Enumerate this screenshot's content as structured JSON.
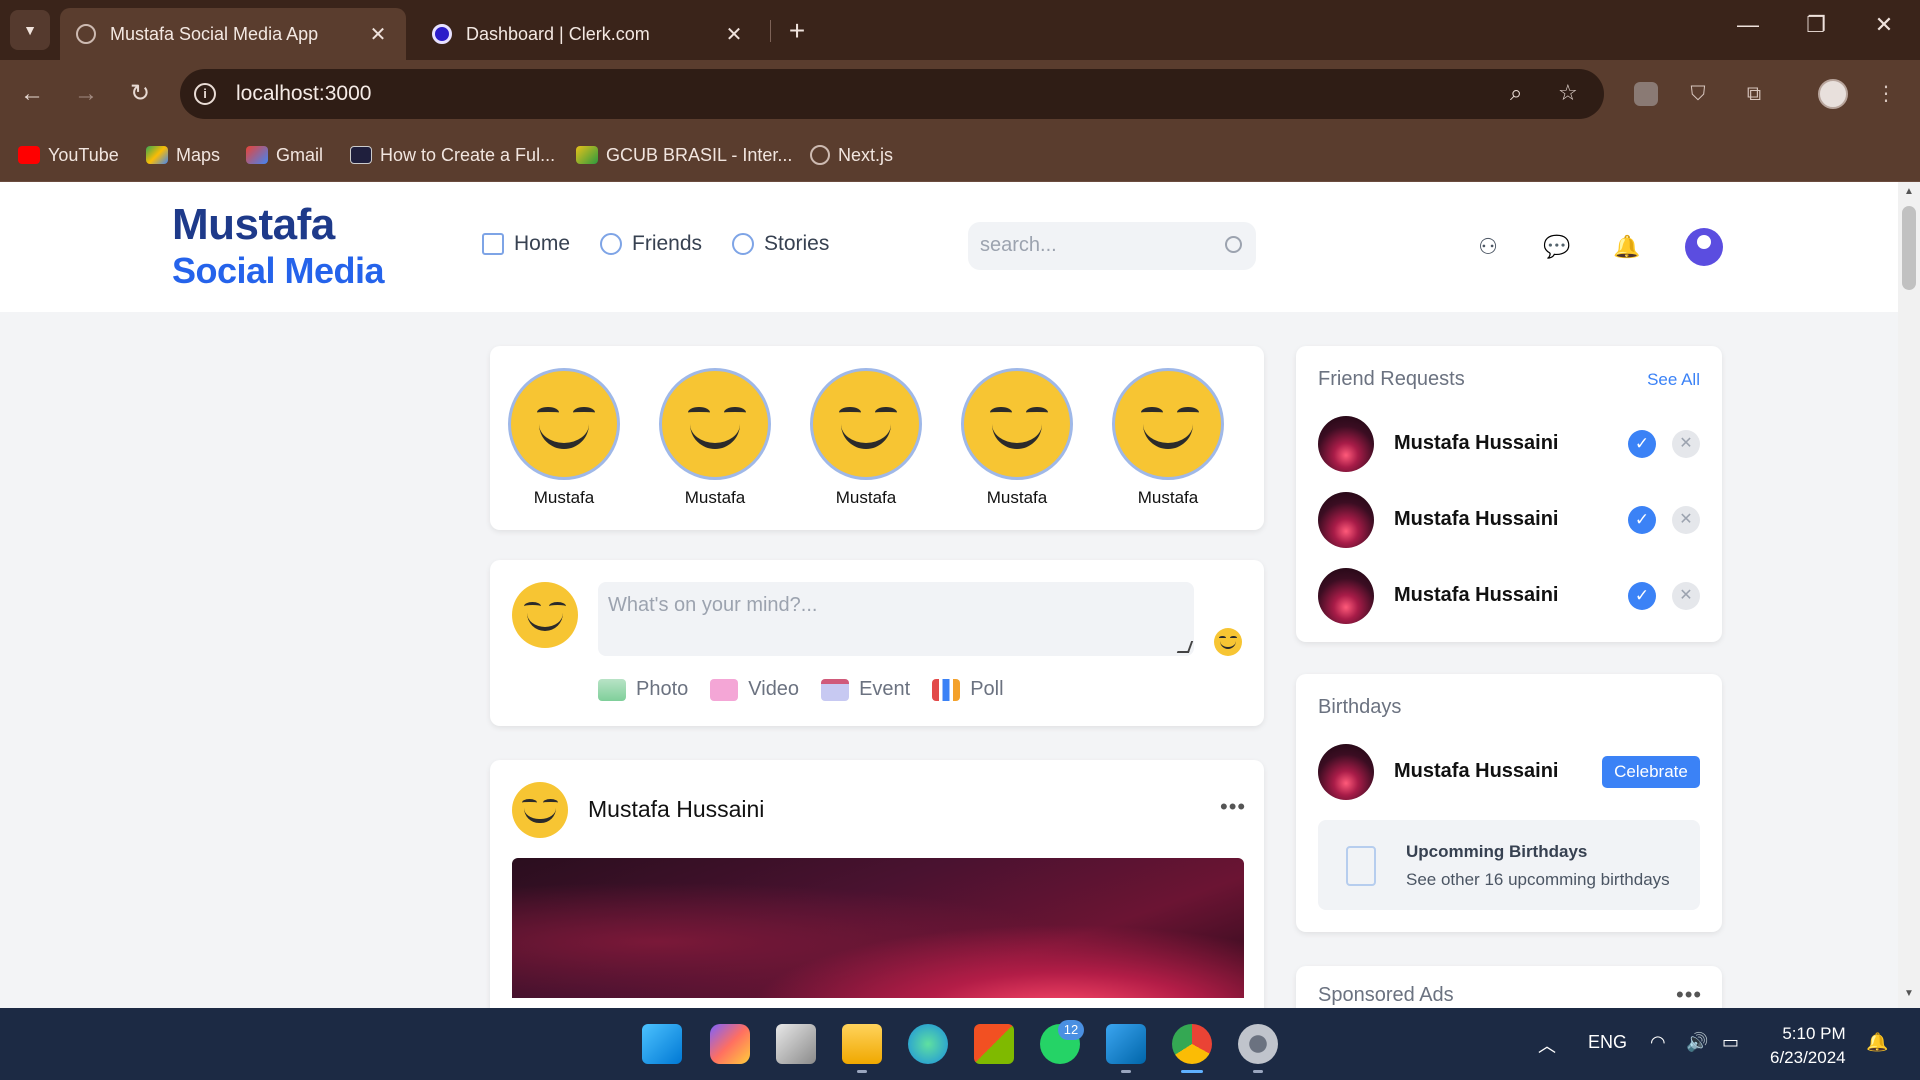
{
  "browser": {
    "tabs": [
      {
        "title": "Mustafa Social Media App",
        "active": true,
        "icon": "globe-icon"
      },
      {
        "title": "Dashboard | Clerk.com",
        "active": false,
        "icon": "clerk-icon"
      }
    ],
    "new_tab_label": "+",
    "close_glyph": "✕",
    "url": "localhost:3000",
    "bookmarks": [
      {
        "label": "YouTube",
        "icon": "youtube-icon",
        "color": "#ff0000"
      },
      {
        "label": "Maps",
        "icon": "maps-icon",
        "color": "#34a853"
      },
      {
        "label": "Gmail",
        "icon": "gmail-icon",
        "color": "#ea4335"
      },
      {
        "label": "How to Create a Ful...",
        "icon": "bookmark-icon",
        "color": "#1f1f3d"
      },
      {
        "label": "GCUB BRASIL - Inter...",
        "icon": "bookmark-icon",
        "color": "#e8c21a"
      },
      {
        "label": "Next.js",
        "icon": "globe-icon",
        "color": "#cdbab1"
      }
    ]
  },
  "app": {
    "logo_line1": "Mustafa",
    "logo_line2": "Social Media",
    "nav_links": [
      {
        "label": "Home",
        "icon": "home-icon"
      },
      {
        "label": "Friends",
        "icon": "friends-icon"
      },
      {
        "label": "Stories",
        "icon": "stories-icon"
      }
    ],
    "search_placeholder": "search...",
    "colors": {
      "brand_dark": "#1e3a8a",
      "brand": "#2563eb",
      "accent": "#3b82f6"
    }
  },
  "stories": [
    {
      "name": "Mustafa"
    },
    {
      "name": "Mustafa"
    },
    {
      "name": "Mustafa"
    },
    {
      "name": "Mustafa"
    },
    {
      "name": "Mustafa"
    }
  ],
  "composer": {
    "placeholder": "What's on your mind?...",
    "actions": [
      {
        "label": "Photo",
        "icon": "photo-icon"
      },
      {
        "label": "Video",
        "icon": "video-icon"
      },
      {
        "label": "Event",
        "icon": "calendar-icon"
      },
      {
        "label": "Poll",
        "icon": "poll-icon"
      }
    ]
  },
  "post": {
    "author": "Mustafa Hussaini",
    "more_glyph": "•••"
  },
  "friend_requests": {
    "title": "Friend Requests",
    "see_all": "See All",
    "items": [
      {
        "name": "Mustafa Hussaini"
      },
      {
        "name": "Mustafa Hussaini"
      },
      {
        "name": "Mustafa Hussaini"
      }
    ]
  },
  "birthdays": {
    "title": "Birthdays",
    "name": "Mustafa Hussaini",
    "celebrate_label": "Celebrate",
    "upcoming_title": "Upcomming Birthdays",
    "upcoming_sub": "See other 16 upcomming birthdays"
  },
  "sponsored": {
    "title": "Sponsored Ads",
    "more_glyph": "•••"
  },
  "taskbar": {
    "whatsapp_badge": "12",
    "language": "ENG",
    "time": "5:10 PM",
    "date": "6/23/2024"
  }
}
